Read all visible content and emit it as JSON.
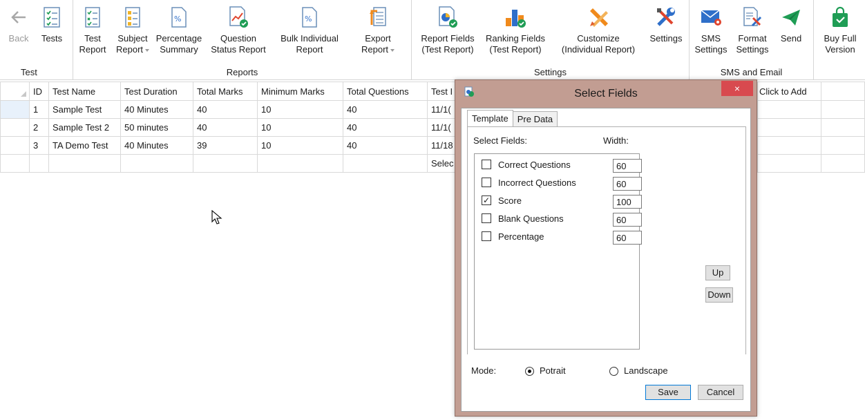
{
  "ribbon": {
    "groups": {
      "test": "Test",
      "reports": "Reports",
      "settings": "Settings",
      "sms": "SMS and Email"
    },
    "buttons": {
      "back": "Back",
      "tests": "Tests",
      "test_report": "Test\nReport",
      "subject_report": "Subject\nReport",
      "percentage_summary": "Percentage\nSummary",
      "question_status": "Question\nStatus Report",
      "bulk_individual": "Bulk Individual\nReport",
      "export_report": "Export\nReport",
      "report_fields": "Report Fields\n(Test Report)",
      "ranking_fields": "Ranking Fields\n(Test Report)",
      "customize": "Customize\n(Individual Report)",
      "settings": "Settings",
      "sms_settings": "SMS\nSettings",
      "format_settings": "Format\nSettings",
      "send": "Send",
      "buy_full": "Buy Full\nVersion"
    }
  },
  "grid": {
    "headers": [
      "ID",
      "Test Name",
      "Test Duration",
      "Total Marks",
      "Minimum Marks",
      "Total Questions",
      "Test I"
    ],
    "add_column": "Click to Add",
    "rows": [
      [
        "1",
        "Sample Test",
        "40 Minutes",
        "40",
        "10",
        "40",
        "11/1("
      ],
      [
        "2",
        "Sample Test 2",
        "50 minutes",
        "40",
        "10",
        "40",
        "11/1("
      ],
      [
        "3",
        "TA Demo Test",
        "40 Minutes",
        "39",
        "10",
        "40",
        "11/18"
      ]
    ],
    "new_row_hint": "Selec"
  },
  "dialog": {
    "title": "Select Fields",
    "close": "×",
    "tabs": [
      "Template",
      "Pre Data"
    ],
    "select_fields_label": "Select Fields:",
    "width_label": "Width:",
    "fields": [
      {
        "name": "Correct Questions",
        "checked": false,
        "width": "60"
      },
      {
        "name": "Incorrect Questions",
        "checked": false,
        "width": "60"
      },
      {
        "name": "Score",
        "checked": true,
        "width": "100"
      },
      {
        "name": "Blank Questions",
        "checked": false,
        "width": "60"
      },
      {
        "name": "Percentage",
        "checked": false,
        "width": "60"
      }
    ],
    "up": "Up",
    "down": "Down",
    "mode_label": "Mode:",
    "mode_options": [
      "Potrait",
      "Landscape"
    ],
    "mode_selected": "Potrait",
    "save": "Save",
    "cancel": "Cancel"
  },
  "colors": {
    "dialog_frame": "#c29d92",
    "close_button": "#d84a4f",
    "icon_green": "#1f9d55",
    "icon_blue": "#2f6fc9",
    "icon_orange": "#f08a1c"
  }
}
